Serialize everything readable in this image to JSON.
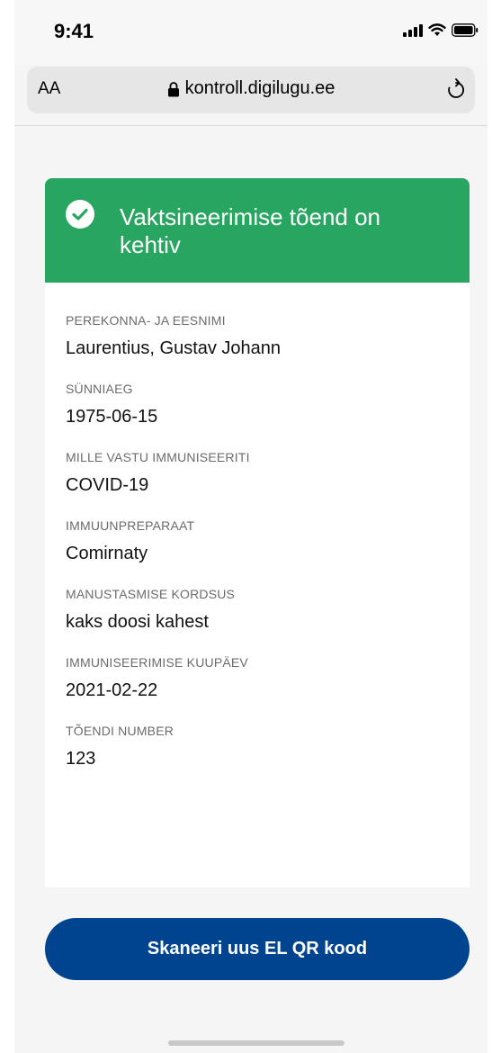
{
  "status_bar": {
    "time": "9:41",
    "icons": [
      "signal-icon",
      "wifi-icon",
      "battery-icon"
    ]
  },
  "browser": {
    "text_size_label": "AA",
    "url": "kontroll.digilugu.ee",
    "lock_icon": "lock-icon",
    "reload_icon": "reload-icon"
  },
  "certificate": {
    "status_title": "Vaktsineerimise tõend on kehtiv",
    "status_color": "#28a661",
    "fields": [
      {
        "label": "PEREKONNA- JA EESNIMI",
        "value": "Laurentius, Gustav Johann"
      },
      {
        "label": "SÜNNIAEG",
        "value": "1975-06-15"
      },
      {
        "label": "MILLE VASTU IMMUNISEERITI",
        "value": "COVID-19"
      },
      {
        "label": "IMMUUNPREPARAAT",
        "value": "Comirnaty"
      },
      {
        "label": "MANUSTASMISE KORDSUS",
        "value": "kaks doosi kahest"
      },
      {
        "label": "IMMUNISEERIMISE KUUPÄEV",
        "value": "2021-02-22"
      },
      {
        "label": "TÕENDI NUMBER",
        "value": "123"
      }
    ]
  },
  "actions": {
    "scan_button_label": "Skaneeri uus EL QR kood",
    "button_color": "#00448f"
  }
}
